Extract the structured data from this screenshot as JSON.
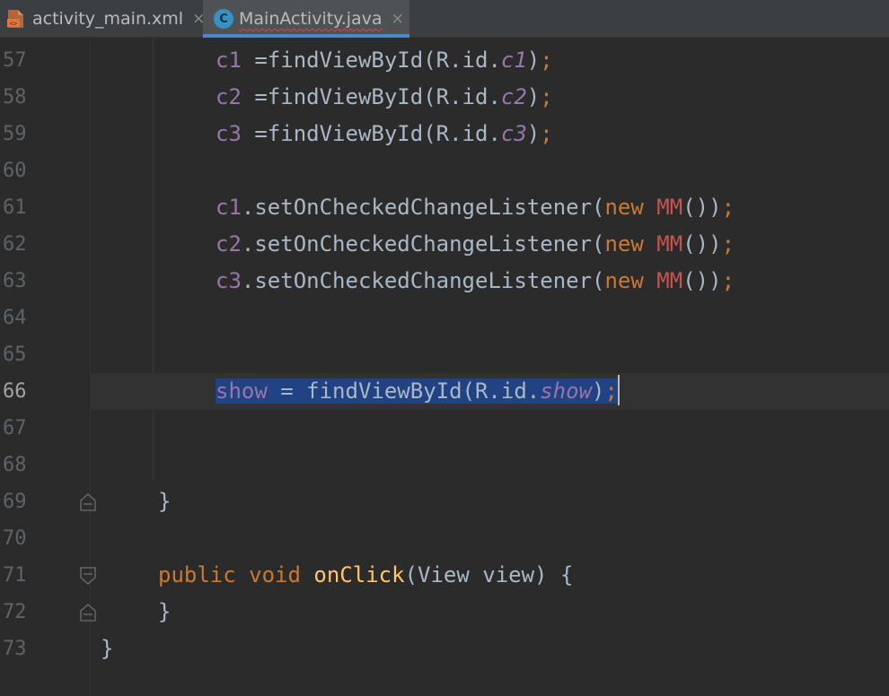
{
  "tabs": [
    {
      "label": "activity_main.xml",
      "icon": "xml-file-icon",
      "active": false
    },
    {
      "label": "MainActivity.java",
      "icon": "java-class-icon",
      "icon_letter": "C",
      "active": true
    }
  ],
  "close_glyph": "×",
  "colors": {
    "background": "#2b2b2b",
    "keyword": "#cc7832",
    "field": "#9876aa",
    "method_decl": "#ffc66d",
    "error_class": "#c75450",
    "default_text": "#a9b7c6",
    "selection": "#214283",
    "active_tab_underline": "#4a88c7"
  },
  "editor": {
    "current_line": "66",
    "lines": [
      {
        "num": "57",
        "c1": "c1",
        "c2": " =findViewById(R.id.",
        "c3": "c1",
        "c4": ")",
        "c5": ";"
      },
      {
        "num": "58",
        "c1": "c2",
        "c2": " =findViewById(R.id.",
        "c3": "c2",
        "c4": ")",
        "c5": ";"
      },
      {
        "num": "59",
        "c1": "c3",
        "c2": " =findViewById(R.id.",
        "c3": "c3",
        "c4": ")",
        "c5": ";"
      },
      {
        "num": "60"
      },
      {
        "num": "61",
        "c1": "c1",
        "c2": ".setOnCheckedChangeListener(",
        "c3": "new",
        "c4": " ",
        "c5": "MM",
        "c6": "())",
        "c7": ";"
      },
      {
        "num": "62",
        "c1": "c2",
        "c2": ".setOnCheckedChangeListener(",
        "c3": "new",
        "c4": " ",
        "c5": "MM",
        "c6": "())",
        "c7": ";"
      },
      {
        "num": "63",
        "c1": "c3",
        "c2": ".setOnCheckedChangeListener(",
        "c3": "new",
        "c4": " ",
        "c5": "MM",
        "c6": "())",
        "c7": ";"
      },
      {
        "num": "64"
      },
      {
        "num": "65"
      },
      {
        "num": "66",
        "c1": "show",
        "c2": " = findViewById(R.id.",
        "c3": "show",
        "c4": ")",
        "c5": ";"
      },
      {
        "num": "67"
      },
      {
        "num": "68"
      },
      {
        "num": "69",
        "c1": "}"
      },
      {
        "num": "70"
      },
      {
        "num": "71",
        "c1": "public",
        "c2": " ",
        "c3": "void",
        "c4": " ",
        "c5": "onClick",
        "c6": "(View view) {"
      },
      {
        "num": "72",
        "c1": "}"
      },
      {
        "num": "73",
        "c1": "}"
      }
    ]
  }
}
